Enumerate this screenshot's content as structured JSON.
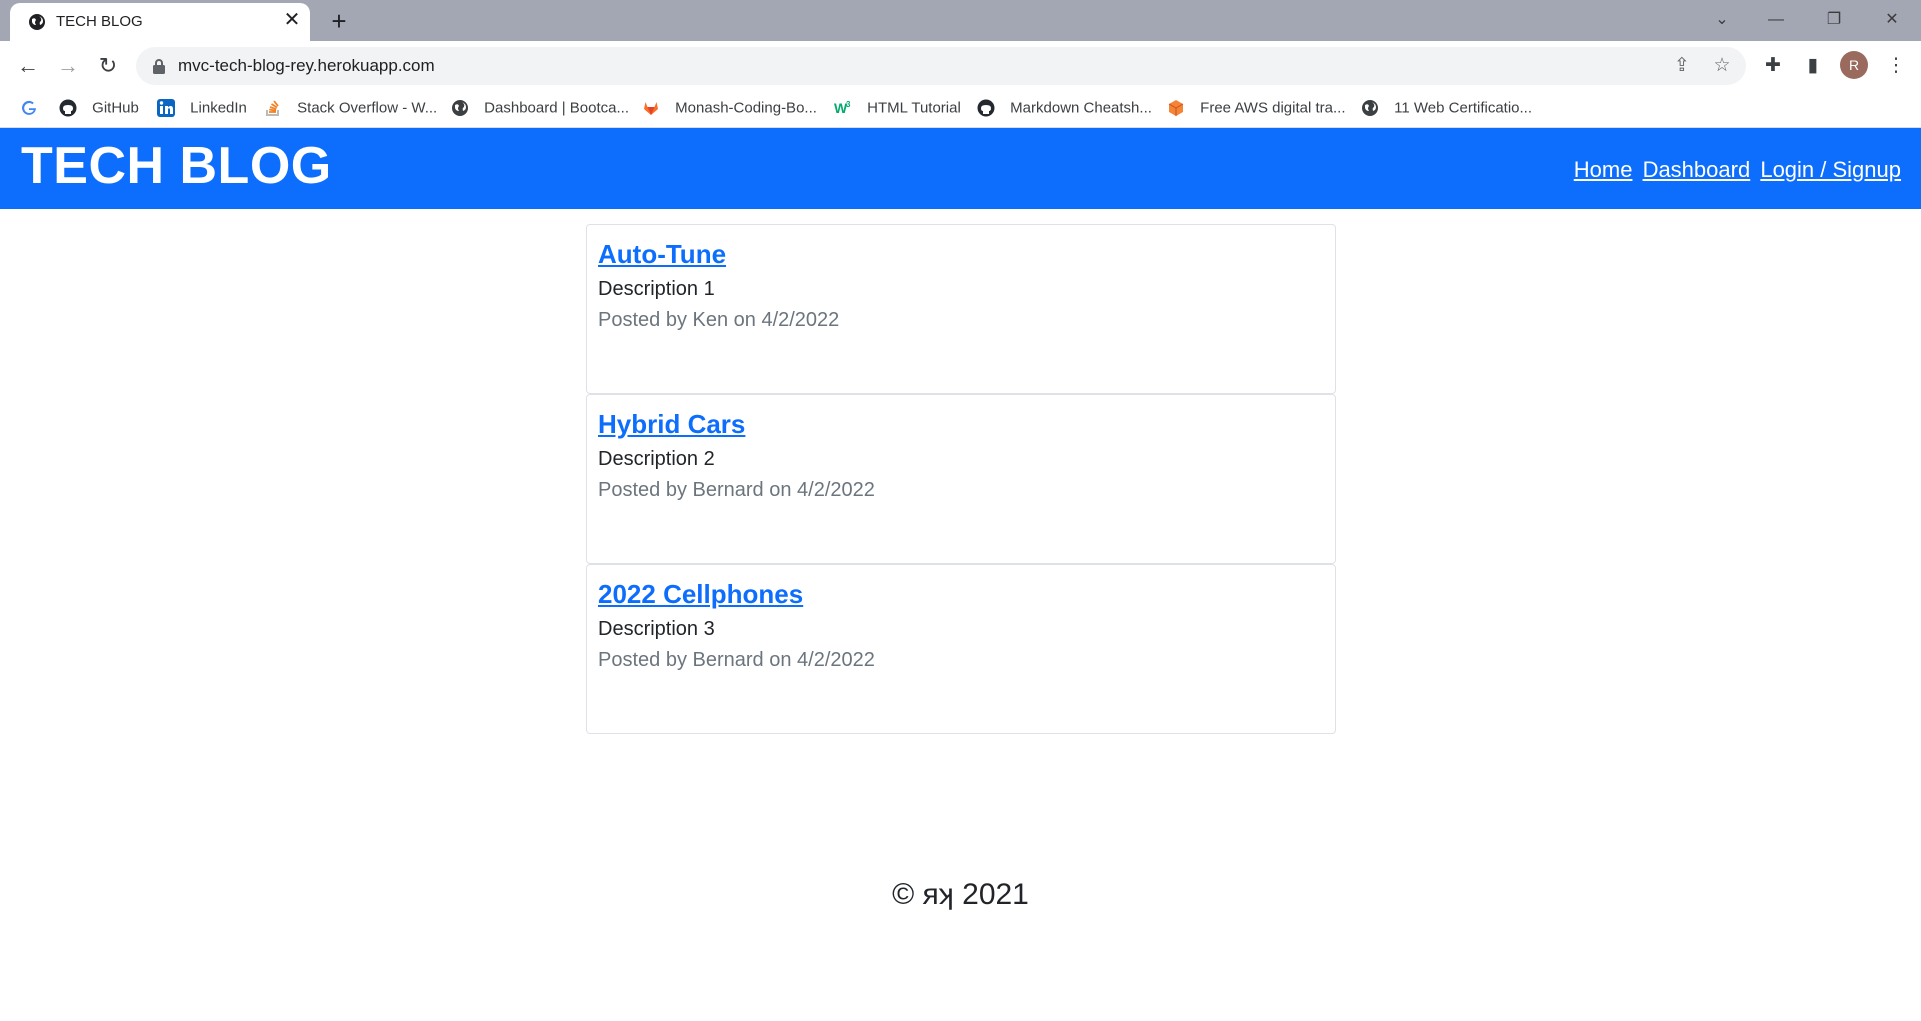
{
  "browser": {
    "tab_title": "TECH BLOG",
    "new_tab": "+",
    "url": "mvc-tech-blog-rey.herokuapp.com",
    "profile_initial": "R",
    "bookmarks": [
      {
        "label": "",
        "icon": "google-icon"
      },
      {
        "label": "GitHub",
        "icon": "github-icon"
      },
      {
        "label": "LinkedIn",
        "icon": "linkedin-icon"
      },
      {
        "label": "Stack Overflow - W...",
        "icon": "stackoverflow-icon"
      },
      {
        "label": "Dashboard | Bootca...",
        "icon": "globe-icon"
      },
      {
        "label": "Monash-Coding-Bo...",
        "icon": "gitlab-icon"
      },
      {
        "label": "HTML Tutorial",
        "icon": "w3schools-icon"
      },
      {
        "label": "Markdown Cheatsh...",
        "icon": "github-icon"
      },
      {
        "label": "Free AWS digital tra...",
        "icon": "aws-icon"
      },
      {
        "label": "11 Web Certificatio...",
        "icon": "globe-icon"
      }
    ]
  },
  "site": {
    "title": "TECH BLOG",
    "nav": {
      "home": "Home",
      "dashboard": "Dashboard",
      "login": "Login / Signup"
    },
    "accent_color": "#0d6efd"
  },
  "posts": [
    {
      "title": "Auto-Tune",
      "description": "Description 1",
      "meta": "Posted by Ken on 4/2/2022"
    },
    {
      "title": "Hybrid Cars",
      "description": "Description 2",
      "meta": "Posted by Bernard on 4/2/2022"
    },
    {
      "title": "2022 Cellphones",
      "description": "Description 3",
      "meta": "Posted by Bernard on 4/2/2022"
    }
  ],
  "footer": {
    "text": "© яʞ 2021"
  }
}
